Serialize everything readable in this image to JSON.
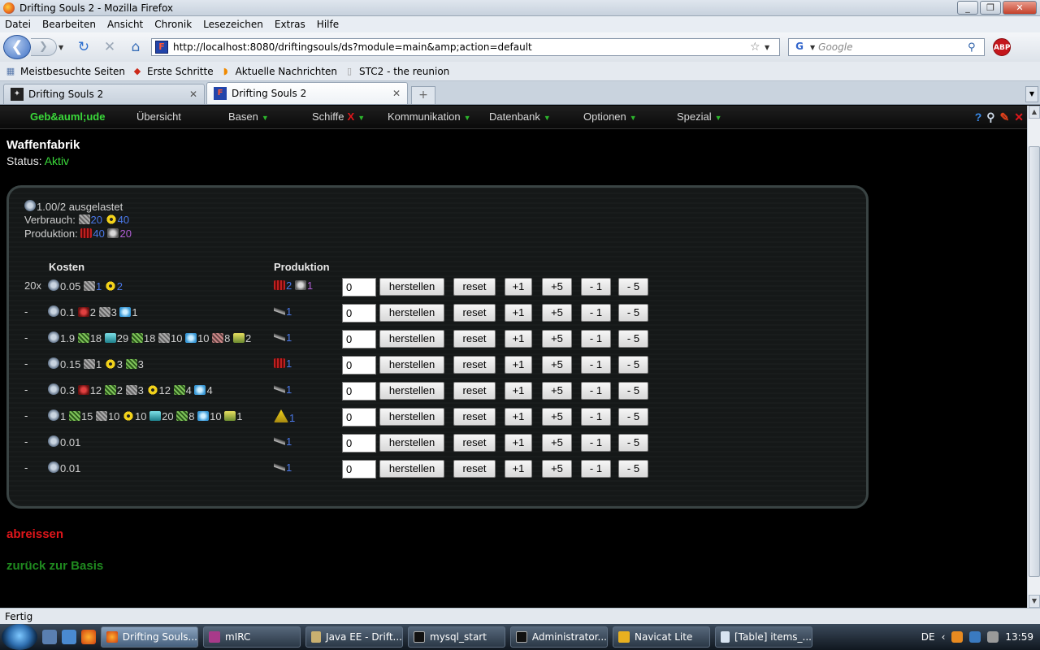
{
  "window": {
    "title": "Drifting Souls 2 - Mozilla Firefox"
  },
  "menu": [
    "Datei",
    "Bearbeiten",
    "Ansicht",
    "Chronik",
    "Lesezeichen",
    "Extras",
    "Hilfe"
  ],
  "nav": {
    "url": "http://localhost:8080/driftingsouls/ds?module=main&amp;action=default",
    "search_placeholder": "Google"
  },
  "bookmarks": [
    "Meistbesuchte Seiten",
    "Erste Schritte",
    "Aktuelle Nachrichten",
    "STC2 - the reunion"
  ],
  "tabs": [
    {
      "label": "Drifting Souls 2"
    },
    {
      "label": "Drifting Souls 2"
    }
  ],
  "game_nav": {
    "items": [
      "Geb&auml;ude",
      "Übersicht",
      "Basen",
      "Schiffe",
      "Kommunikation",
      "Datenbank",
      "Optionen",
      "Spezial"
    ],
    "schiffe_x": "X"
  },
  "building": {
    "title": "Waffenfabrik",
    "status_label": "Status:",
    "status_value": "Aktiv"
  },
  "panel": {
    "usage": "1.00/2 ausgelastet",
    "verbrauch_label": "Verbrauch:",
    "verbrauch_1": "20",
    "verbrauch_2": "40",
    "produktion_label": "Produktion:",
    "produktion_1": "40",
    "produktion_2": "20",
    "col_kosten": "Kosten",
    "col_produktion": "Produktion",
    "rows": [
      {
        "count": "20x",
        "cost": [
          "0.05",
          "1",
          "2"
        ],
        "prod": [
          "2",
          "1"
        ],
        "qty": "0"
      },
      {
        "count": "-",
        "cost": [
          "0.1",
          "2",
          "3",
          "1"
        ],
        "prod": [
          "1"
        ],
        "qty": "0"
      },
      {
        "count": "-",
        "cost": [
          "1.9",
          "18",
          "29",
          "18",
          "10",
          "10",
          "8",
          "2"
        ],
        "prod": [
          "1"
        ],
        "qty": "0"
      },
      {
        "count": "-",
        "cost": [
          "0.15",
          "1",
          "3",
          "3"
        ],
        "prod": [
          "1"
        ],
        "qty": "0"
      },
      {
        "count": "-",
        "cost": [
          "0.3",
          "12",
          "2",
          "3",
          "12",
          "4",
          "4"
        ],
        "prod": [
          "1"
        ],
        "qty": "0"
      },
      {
        "count": "-",
        "cost": [
          "1",
          "15",
          "10",
          "10",
          "20",
          "8",
          "10",
          "1"
        ],
        "prod": [
          "1"
        ],
        "qty": "0"
      },
      {
        "count": "-",
        "cost": [
          "0.01"
        ],
        "prod": [
          "1"
        ],
        "qty": "0"
      },
      {
        "count": "-",
        "cost": [
          "0.01"
        ],
        "prod": [
          "1"
        ],
        "qty": "0"
      }
    ],
    "buttons": {
      "herstellen": "herstellen",
      "reset": "reset",
      "p1": "+1",
      "p5": "+5",
      "m1": "- 1",
      "m5": "- 5"
    }
  },
  "links": {
    "abreissen": "abreissen",
    "zurueck": "zurück zur Basis"
  },
  "statusbar": "Fertig",
  "taskbar": {
    "items": [
      "Drifting Souls...",
      "mIRC",
      "Java EE - Drift...",
      "mysql_start",
      "Administrator...",
      "Navicat Lite",
      "[Table] items_..."
    ],
    "lang": "DE",
    "clock": "13:59"
  }
}
